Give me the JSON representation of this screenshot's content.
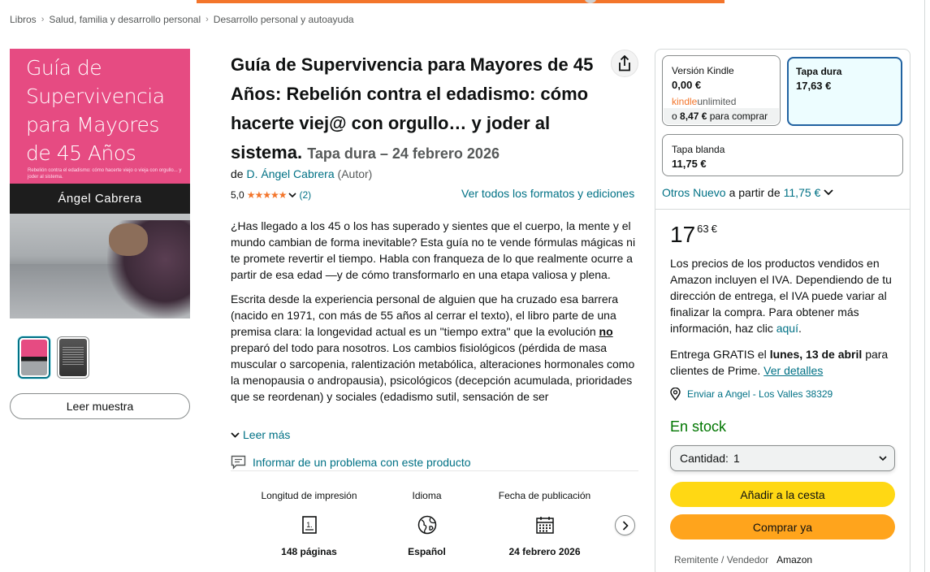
{
  "breadcrumb": [
    "Libros",
    "Salud, familia y desarrollo personal",
    "Desarrollo personal y autoayuda"
  ],
  "cover": {
    "title": "Guía de Supervivencia para Mayores de 45 Años",
    "subtitle": "Rebelión contra el edadismo: cómo hacerte viejo o vieja con orgullo... y joder al sistema.",
    "author": "Ángel Cabrera"
  },
  "sample_button": "Leer muestra",
  "product": {
    "title": "Guía de Supervivencia para Mayores de 45 Años: Rebelión contra el edadismo: cómo hacerte viej@ con orgullo… y joder al sistema.",
    "format_date": "Tapa dura – 24 febrero 2026",
    "by": "de",
    "author": "D. Ángel Cabrera",
    "author_role": "(Autor)",
    "rating": "5,0",
    "stars": "★★★★★",
    "review_count": "(2)",
    "all_formats_link": "Ver todos los formatos y ediciones"
  },
  "description": {
    "p1": "¿Has llegado a los 45 o los has superado y sientes que el cuerpo, la mente y el mundo cambian de forma inevitable? Esta guía no te vende fórmulas mágicas ni te promete revertir el tiempo. Habla con franqueza de lo que realmente ocurre a partir de esa edad —y de cómo transformarlo en una etapa valiosa y plena.",
    "p2_before": "Escrita desde la experiencia personal de alguien que ha cruzado esa barrera (nacido en 1971, con más de 55 años al cerrar el texto), el libro parte de una premisa clara: la longevidad actual es un \"tiempo extra\" que la evolución ",
    "p2_emph": "no",
    "p2_after": " preparó del todo para nosotros. Los cambios fisiológicos (pérdida de masa muscular o sarcopenia, ralentización metabólica, alteraciones hormonales como la menopausia o andropausia), psicológicos (decepción acumulada, prioridades que se reordenan) y sociales (edadismo sutil, sensación de ser",
    "read_more": "Leer más"
  },
  "report_problem": "Informar de un problema con este producto",
  "attributes": [
    {
      "label": "Longitud de impresión",
      "icon": "page-icon",
      "value": "148 páginas"
    },
    {
      "label": "Idioma",
      "icon": "globe-icon",
      "value": "Español"
    },
    {
      "label": "Fecha de publicación",
      "icon": "calendar-icon",
      "value": "24 febrero 2026"
    }
  ],
  "formats": {
    "kindle": {
      "name": "Versión Kindle",
      "price": "0,00 €",
      "ku_brand": "kindle",
      "ku_unlimited": "unlimited",
      "ku_prefix": "o",
      "ku_price": "8,47 €",
      "ku_suffix": "para comprar"
    },
    "hardcover": {
      "name": "Tapa dura",
      "price": "17,63 €"
    },
    "paperback": {
      "name": "Tapa blanda",
      "price": "11,75 €"
    }
  },
  "others": {
    "label": "Otros Nuevo",
    "prefix": "a partir de",
    "price": "11,75 €"
  },
  "buybox": {
    "price_whole": "17",
    "price_fraction": "63",
    "currency": "€",
    "vat_note": "Los precios de los productos vendidos en Amazon incluyen el IVA. Dependiendo de tu dirección de entrega, el IVA puede variar al finalizar la compra. Para obtener más información, haz clic",
    "vat_link": "aquí",
    "delivery_prefix": "Entrega GRATIS el",
    "delivery_date": "lunes, 13 de abril",
    "delivery_suffix": "para clientes de Prime.",
    "delivery_link": "Ver detalles",
    "ship_to": "Enviar a Angel - Los Valles 38329",
    "stock": "En stock",
    "qty_label": "Cantidad:",
    "qty_value": "1",
    "add_to_cart": "Añadir a la cesta",
    "buy_now": "Comprar ya",
    "seller_label": "Remitente / Vendedor",
    "seller_value": "Amazon"
  },
  "colors": {
    "accent_link": "#007185",
    "star": "#F3752B",
    "cart_button": "#FFD814",
    "buy_button": "#FFA41C",
    "stock": "#007600",
    "selected_border": "#2162A1"
  }
}
